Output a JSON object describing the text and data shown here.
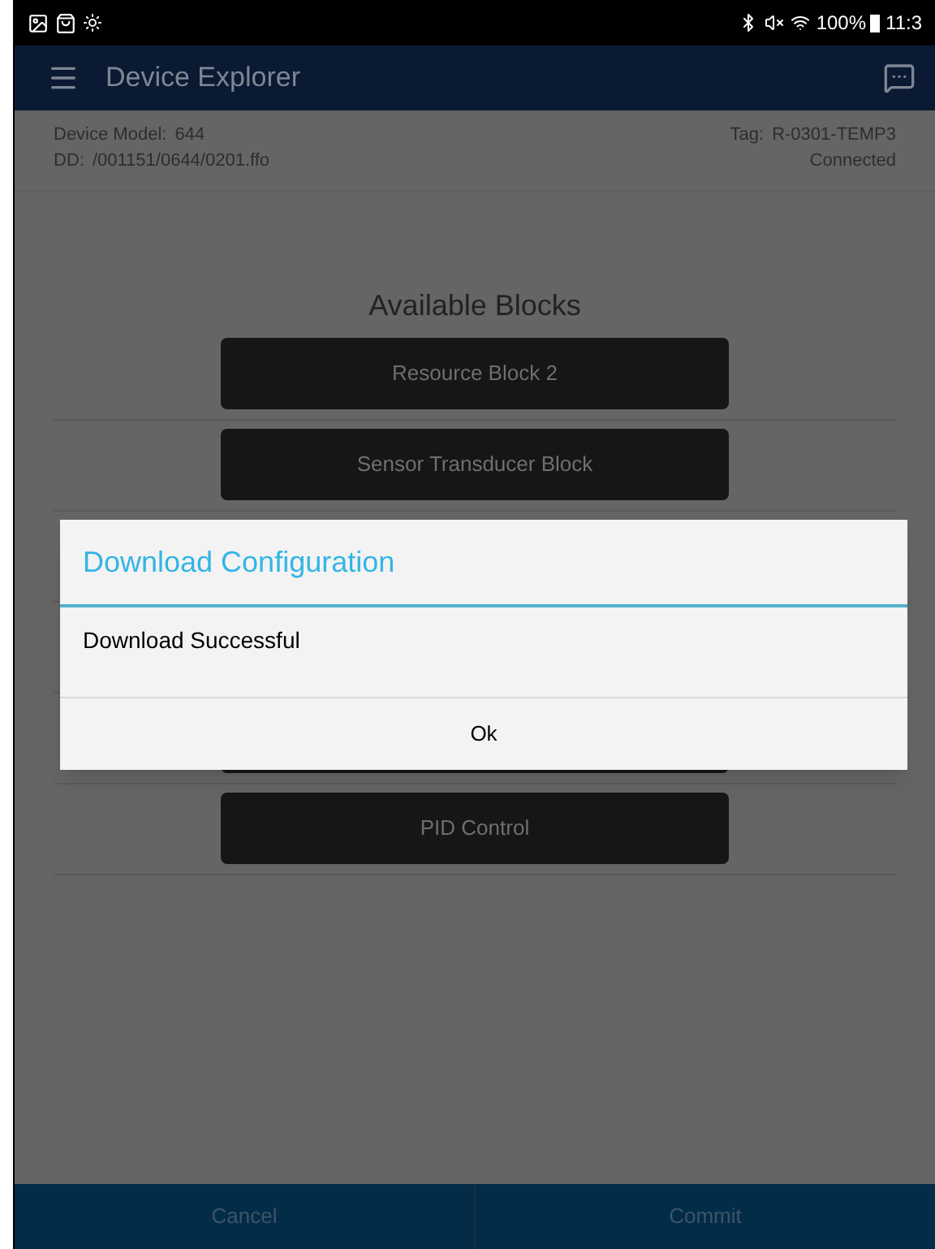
{
  "status_bar": {
    "battery": "100%",
    "time": "11:3"
  },
  "app_bar": {
    "title": "Device Explorer"
  },
  "device": {
    "model_label": "Device Model:",
    "model": "644",
    "dd_label": "DD:",
    "dd": "/001151/0644/0201.ffo",
    "tag_label": "Tag:",
    "tag": "R-0301-TEMP3",
    "status": "Connected"
  },
  "heading": "Available Blocks",
  "blocks": [
    {
      "label": "Resource Block 2"
    },
    {
      "label": "Sensor Transducer Block"
    },
    {
      "label": "PID Control"
    }
  ],
  "dialog": {
    "title": "Download Configuration",
    "message": "Download Successful",
    "button": "Ok"
  },
  "bottom_bar": [
    {
      "label": "Cancel"
    },
    {
      "label": "Commit"
    }
  ]
}
